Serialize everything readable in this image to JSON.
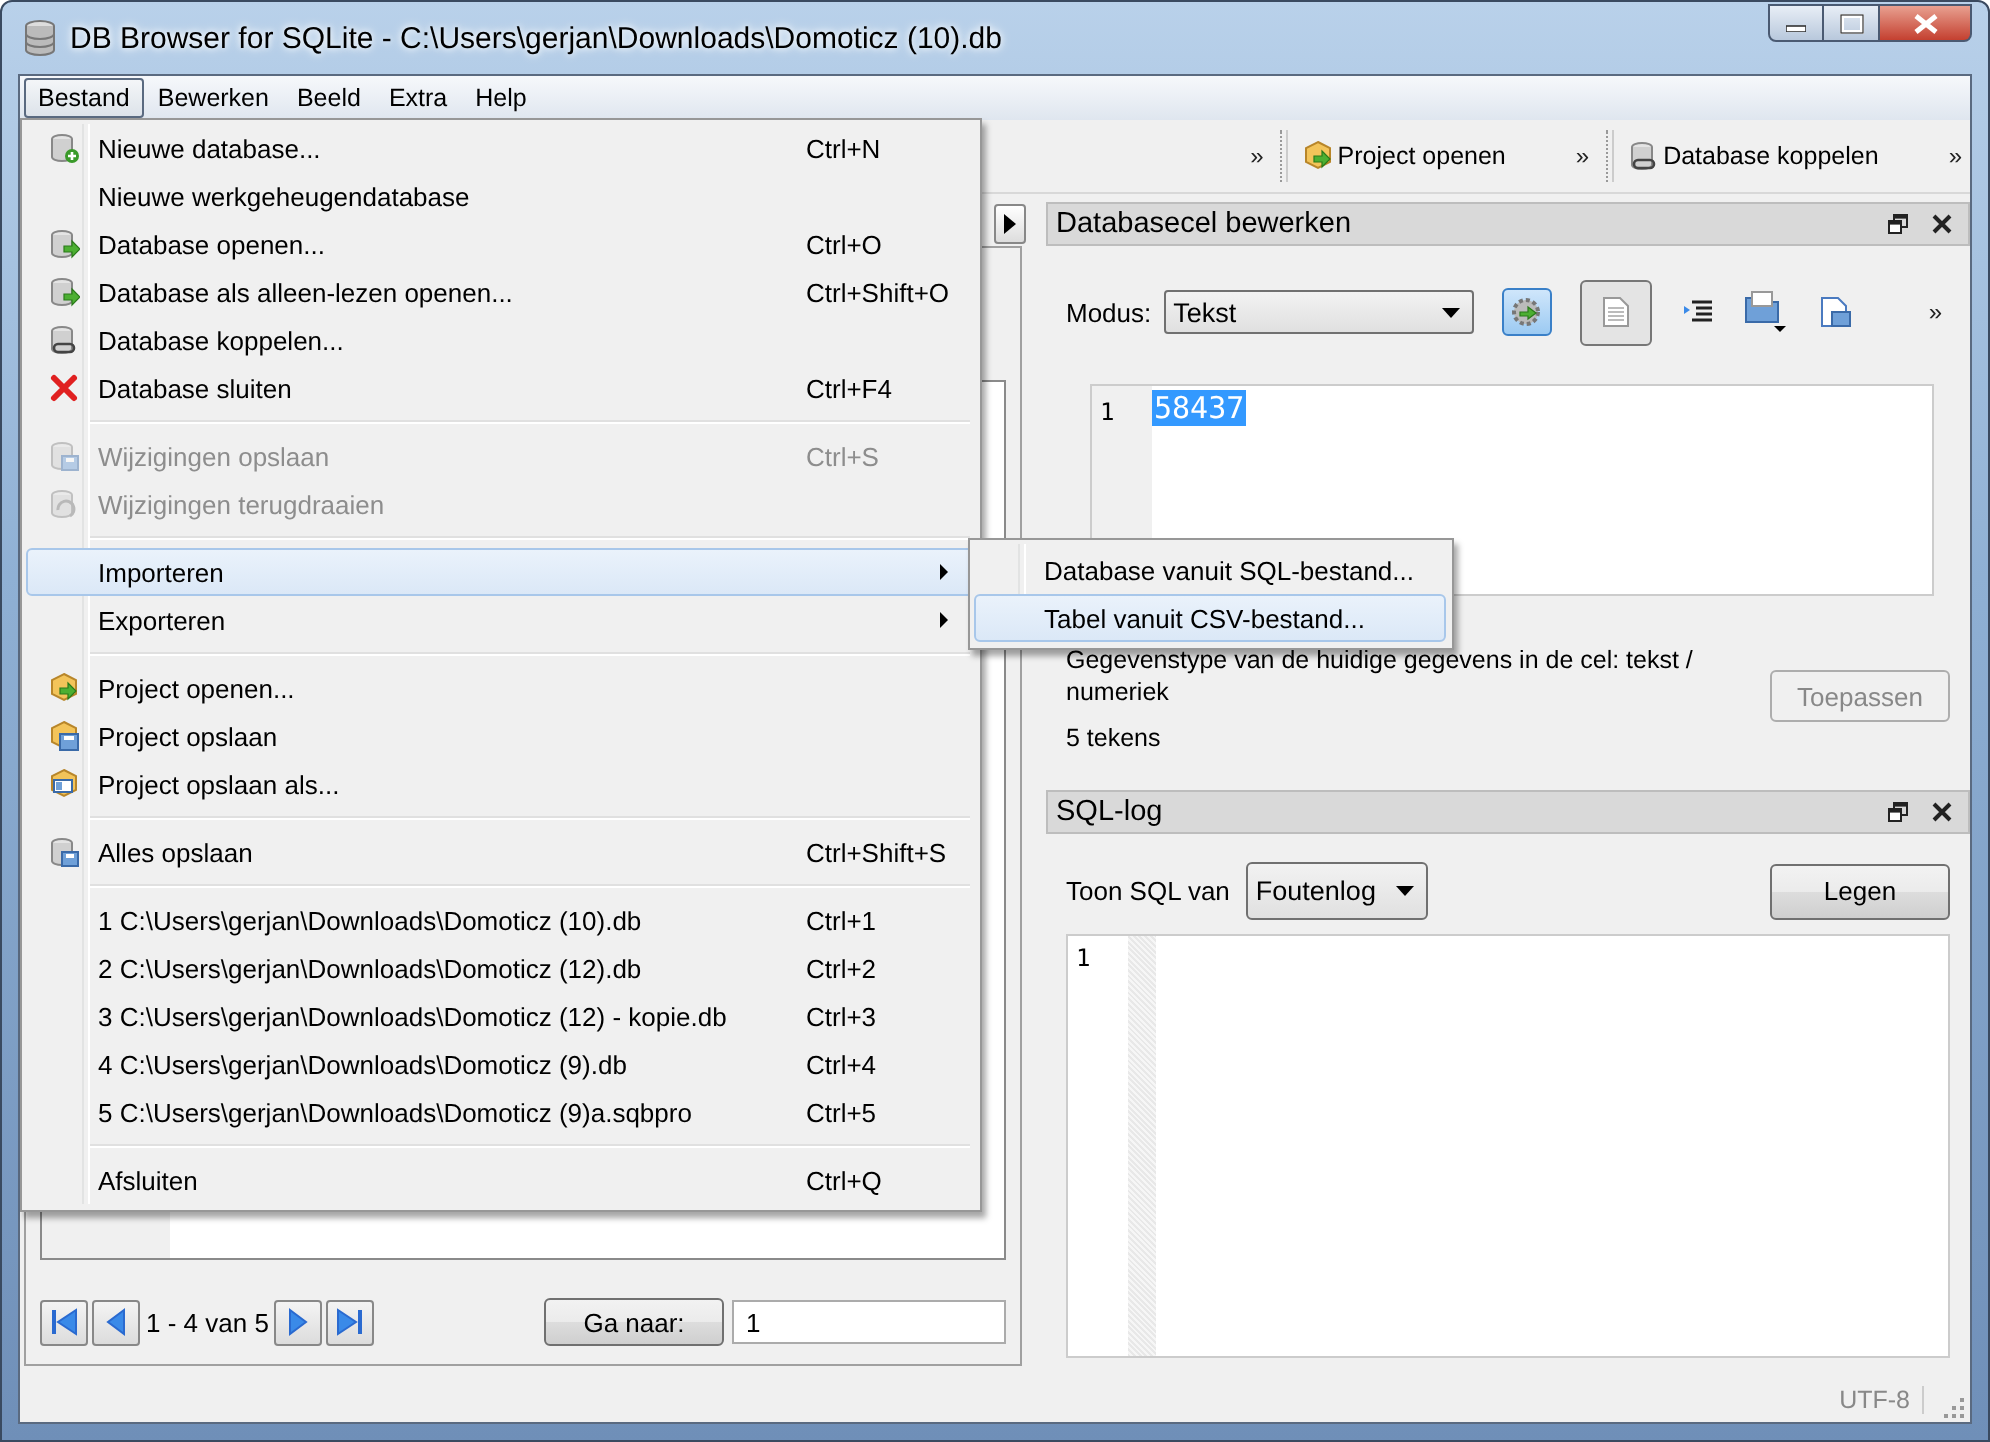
{
  "window": {
    "title": "DB Browser for SQLite - C:\\Users\\gerjan\\Downloads\\Domoticz (10).db"
  },
  "menubar": [
    {
      "label": "Bestand",
      "selected": true
    },
    {
      "label": "Bewerken",
      "selected": false
    },
    {
      "label": "Beeld",
      "selected": false
    },
    {
      "label": "Extra",
      "selected": false
    },
    {
      "label": "Help",
      "selected": false
    }
  ],
  "toolbar": [
    {
      "kind": "chevron",
      "text": "»"
    },
    {
      "kind": "button",
      "label": "Project openen"
    },
    {
      "kind": "chevron",
      "text": "»"
    },
    {
      "kind": "button",
      "label": "Database koppelen"
    },
    {
      "kind": "chevron",
      "text": "»"
    }
  ],
  "file_menu": [
    [
      {
        "label": "Nieuwe database...",
        "shortcut": "Ctrl+N",
        "disabled": false,
        "selected": false
      },
      {
        "label": "Nieuwe werkgeheugendatabase",
        "disabled": false,
        "selected": false
      },
      {
        "label": "Database openen...",
        "shortcut": "Ctrl+O",
        "disabled": false,
        "selected": false
      },
      {
        "label": "Database als alleen-lezen openen...",
        "shortcut": "Ctrl+Shift+O",
        "disabled": false,
        "selected": false
      },
      {
        "label": "Database koppelen...",
        "disabled": false,
        "selected": false
      },
      {
        "label": "Database sluiten",
        "shortcut": "Ctrl+F4",
        "disabled": false,
        "selected": false
      }
    ],
    [
      {
        "label": "Wijzigingen opslaan",
        "shortcut": "Ctrl+S",
        "disabled": true,
        "selected": false
      },
      {
        "label": "Wijzigingen terugdraaien",
        "disabled": true,
        "selected": false
      }
    ],
    [
      {
        "label": "Importeren",
        "submenu": true,
        "disabled": false,
        "selected": true
      },
      {
        "label": "Exporteren",
        "submenu": true,
        "disabled": false,
        "selected": false
      }
    ],
    [
      {
        "label": "Project openen...",
        "disabled": false,
        "selected": false
      },
      {
        "label": "Project opslaan",
        "disabled": false,
        "selected": false
      },
      {
        "label": "Project opslaan als...",
        "disabled": false,
        "selected": false
      }
    ],
    [
      {
        "label": "Alles opslaan",
        "shortcut": "Ctrl+Shift+S",
        "disabled": false,
        "selected": false
      }
    ],
    [
      {
        "label": "1 C:\\Users\\gerjan\\Downloads\\Domoticz (10).db",
        "shortcut": "Ctrl+1",
        "disabled": false,
        "selected": false
      },
      {
        "label": "2 C:\\Users\\gerjan\\Downloads\\Domoticz (12).db",
        "shortcut": "Ctrl+2",
        "disabled": false,
        "selected": false
      },
      {
        "label": "3 C:\\Users\\gerjan\\Downloads\\Domoticz (12) - kopie.db",
        "shortcut": "Ctrl+3",
        "disabled": false,
        "selected": false
      },
      {
        "label": "4 C:\\Users\\gerjan\\Downloads\\Domoticz (9).db",
        "shortcut": "Ctrl+4",
        "disabled": false,
        "selected": false
      },
      {
        "label": "5 C:\\Users\\gerjan\\Downloads\\Domoticz (9)a.sqbpro",
        "shortcut": "Ctrl+5",
        "disabled": false,
        "selected": false
      }
    ],
    [
      {
        "label": "Afsluiten",
        "shortcut": "Ctrl+Q",
        "disabled": false,
        "selected": false
      }
    ]
  ],
  "import_submenu": [
    {
      "label": "Database vanuit SQL-bestand...",
      "selected": false
    },
    {
      "label": "Tabel vanuit CSV-bestand...",
      "selected": true
    }
  ],
  "browse_pane": {
    "range": "1 - 4 van 5",
    "goto_button": "Ga naar:",
    "goto_value": "1"
  },
  "cell_editor": {
    "title": "Databasecel bewerken",
    "mode_label": "Modus:",
    "mode": "Tekst",
    "overflow": "»",
    "line_number": "1",
    "value": "58437",
    "type_info": "Gegevenstype van de huidige gegevens in de cel: tekst / numeriek",
    "char_count": "5 tekens",
    "apply": "Toepassen",
    "apply_disabled": true
  },
  "sql_log": {
    "title": "SQL-log",
    "source_label": "Toon SQL van",
    "source": "Foutenlog",
    "clear": "Legen",
    "line_number": "1"
  },
  "status_bar": {
    "encoding": "UTF-8"
  }
}
